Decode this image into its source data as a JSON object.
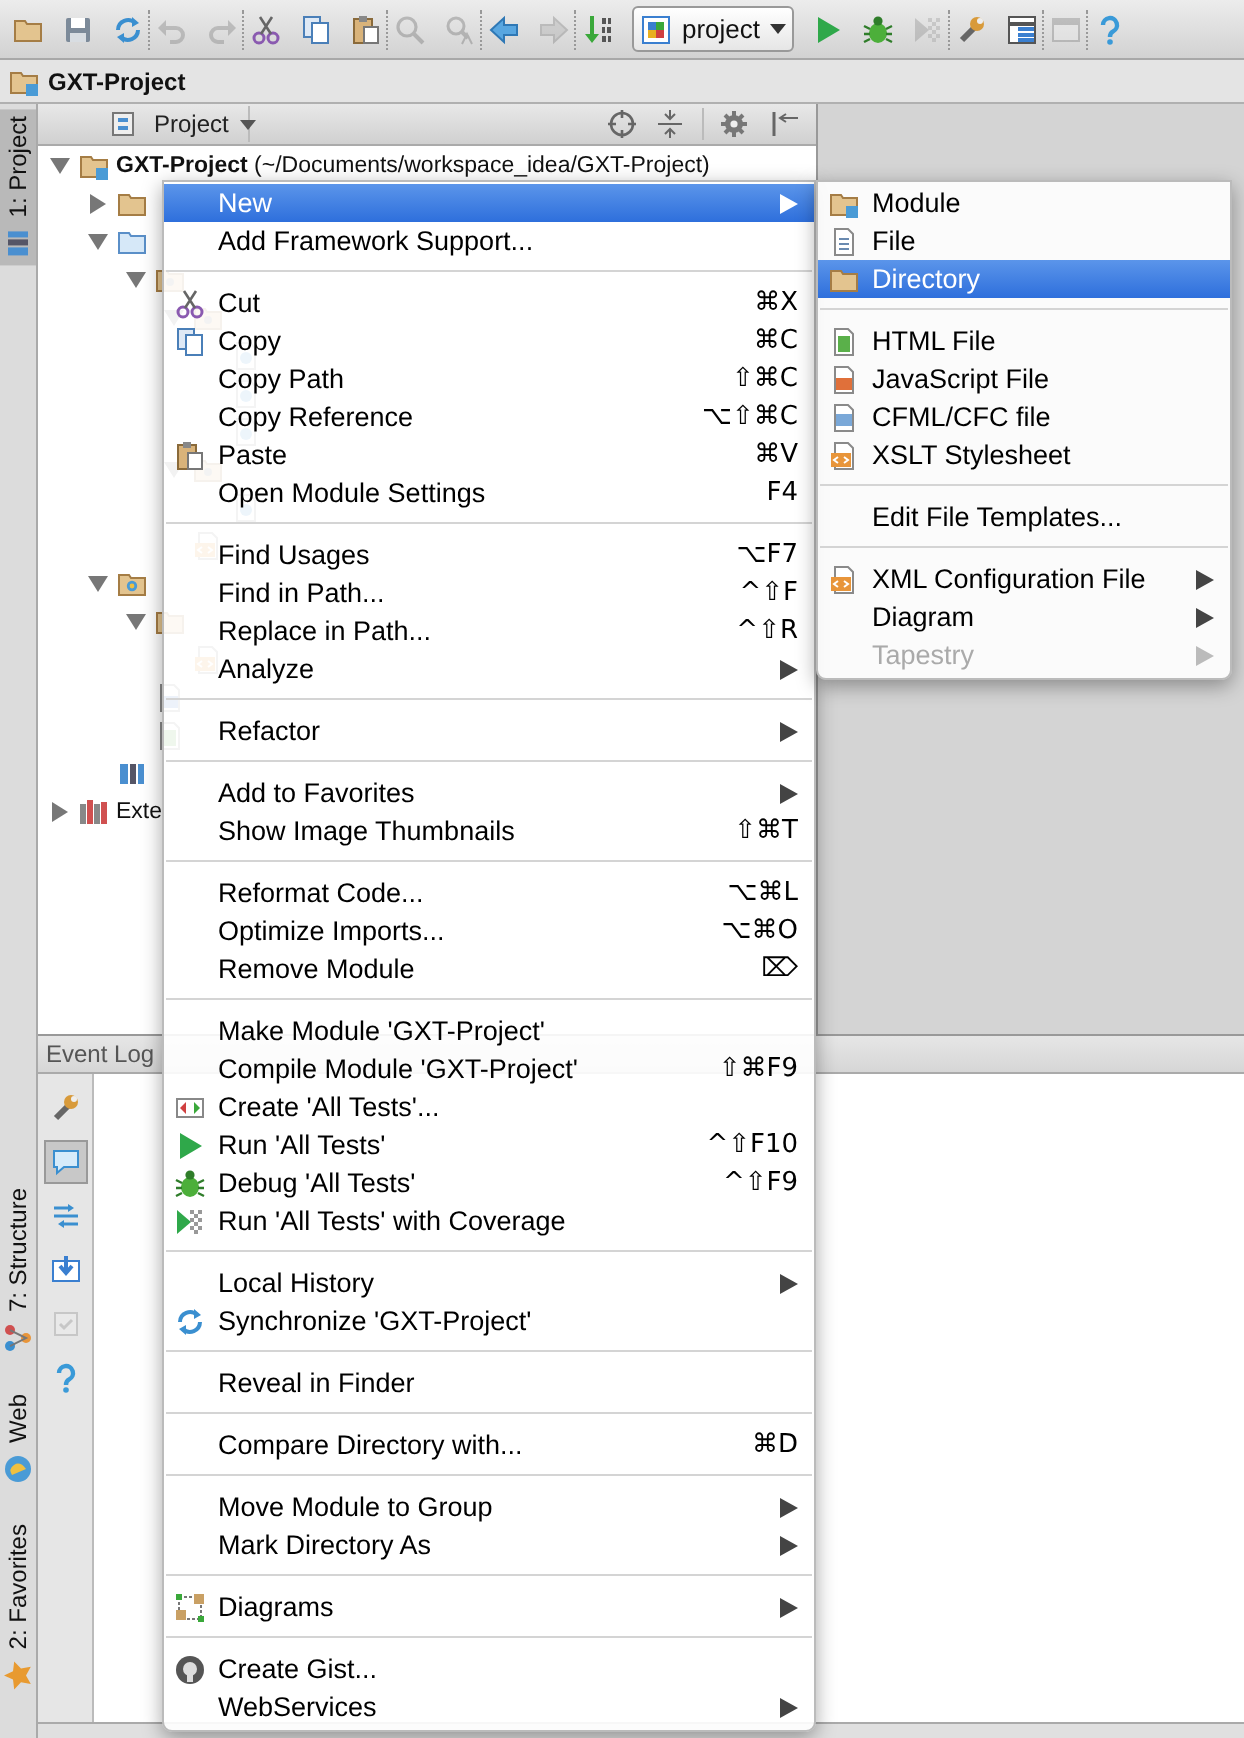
{
  "toolbar": [
    {
      "kind": "open",
      "disabled": false
    },
    {
      "kind": "save",
      "disabled": false
    },
    {
      "kind": "sync",
      "disabled": false
    },
    {
      "kind": "separator"
    },
    {
      "kind": "undo",
      "disabled": true
    },
    {
      "kind": "redo",
      "disabled": true
    },
    {
      "kind": "separator"
    },
    {
      "kind": "cut",
      "disabled": false
    },
    {
      "kind": "copy",
      "disabled": false
    },
    {
      "kind": "paste",
      "disabled": false
    },
    {
      "kind": "separator"
    },
    {
      "kind": "find",
      "disabled": true
    },
    {
      "kind": "replace",
      "disabled": true
    },
    {
      "kind": "separator"
    },
    {
      "kind": "back",
      "disabled": false
    },
    {
      "kind": "forward",
      "disabled": true
    },
    {
      "kind": "separator"
    },
    {
      "kind": "make",
      "disabled": false
    },
    {
      "kind": "config",
      "label": "project"
    },
    {
      "kind": "run",
      "disabled": false
    },
    {
      "kind": "debug",
      "disabled": false
    },
    {
      "kind": "coverage",
      "disabled": true
    },
    {
      "kind": "separator"
    },
    {
      "kind": "settings",
      "disabled": false
    },
    {
      "kind": "structure",
      "disabled": false
    },
    {
      "kind": "separator"
    },
    {
      "kind": "sdk",
      "disabled": true
    },
    {
      "kind": "separator"
    },
    {
      "kind": "help",
      "disabled": false
    }
  ],
  "breadcrumb": {
    "label": "GXT-Project"
  },
  "side_strip": {
    "tabs": [
      {
        "kind": "project",
        "label": "1: Project",
        "selected": true
      },
      {
        "kind": "structure",
        "label": "7: Structure",
        "selected": false
      },
      {
        "kind": "web",
        "label": "Web",
        "selected": false
      },
      {
        "kind": "favorites",
        "label": "2: Favorites",
        "selected": false
      }
    ]
  },
  "project_panel": {
    "view": "Project",
    "tree": [
      {
        "kind": "module",
        "label": "**GXT-Project** (~/Documents/workspace_idea/GXT-Project)",
        "expanded": true,
        "children": [
          {
            "kind": "folder",
            "expanded": false
          },
          {
            "kind": "source",
            "expanded": true,
            "children": [
              {
                "kind": "package",
                "expanded": true,
                "children": [
                  {
                    "kind": "package",
                    "expanded": true,
                    "children": [
                      {
                        "kind": "class"
                      },
                      {
                        "kind": "class"
                      },
                      {
                        "kind": "class"
                      }
                    ]
                  },
                  {
                    "kind": "package",
                    "expanded": true,
                    "children": [
                      {
                        "kind": "class"
                      }
                    ]
                  },
                  {
                    "kind": "xml"
                  }
                ]
              }
            ]
          },
          {
            "kind": "web",
            "expanded": true,
            "children": [
              {
                "kind": "folder",
                "expanded": true,
                "children": [
                  {
                    "kind": "xml"
                  }
                ]
              },
              {
                "kind": "css"
              },
              {
                "kind": "html"
              }
            ]
          },
          {
            "kind": "iml"
          }
        ]
      },
      {
        "kind": "library",
        "label": "Exte",
        "expanded": false
      }
    ]
  },
  "event_log": {
    "title": "Event Log",
    "tools": [
      {
        "kind": "settings",
        "selected": false,
        "disabled": false
      },
      {
        "kind": "messages",
        "selected": true,
        "disabled": false
      },
      {
        "kind": "expand",
        "selected": false,
        "disabled": false
      },
      {
        "kind": "import",
        "selected": false,
        "disabled": false
      },
      {
        "kind": "checkbox",
        "selected": false,
        "disabled": true
      },
      {
        "kind": "help",
        "selected": false,
        "disabled": false
      }
    ]
  },
  "context_menu": {
    "groups": [
      [
        {
          "kind": "plain",
          "label": "New",
          "submenu": true,
          "selected": true,
          "disabled": false
        },
        {
          "kind": "plain",
          "label": "Add Framework Support...",
          "submenu": false,
          "selected": false,
          "disabled": false
        }
      ],
      [
        {
          "kind": "cut",
          "label": "Cut",
          "shortcut": "⌘X",
          "submenu": false,
          "selected": false,
          "disabled": false
        },
        {
          "kind": "copy",
          "label": "Copy",
          "shortcut": "⌘C",
          "submenu": false,
          "selected": false,
          "disabled": false
        },
        {
          "kind": "plain",
          "label": "Copy Path",
          "shortcut": "⇧⌘C",
          "submenu": false,
          "selected": false,
          "disabled": false
        },
        {
          "kind": "plain",
          "label": "Copy Reference",
          "shortcut": "⌥⇧⌘C",
          "submenu": false,
          "selected": false,
          "disabled": false
        },
        {
          "kind": "paste",
          "label": "Paste",
          "shortcut": "⌘V",
          "submenu": false,
          "selected": false,
          "disabled": false
        },
        {
          "kind": "plain",
          "label": "Open Module Settings",
          "shortcut": "F4",
          "submenu": false,
          "selected": false,
          "disabled": false
        }
      ],
      [
        {
          "kind": "plain",
          "label": "Find Usages",
          "shortcut": "⌥F7",
          "submenu": false,
          "selected": false,
          "disabled": false
        },
        {
          "kind": "plain",
          "label": "Find in Path...",
          "shortcut": "^⇧F",
          "submenu": false,
          "selected": false,
          "disabled": false
        },
        {
          "kind": "plain",
          "label": "Replace in Path...",
          "shortcut": "^⇧R",
          "submenu": false,
          "selected": false,
          "disabled": false
        },
        {
          "kind": "plain",
          "label": "Analyze",
          "submenu": true,
          "selected": false,
          "disabled": false
        }
      ],
      [
        {
          "kind": "plain",
          "label": "Refactor",
          "submenu": true,
          "selected": false,
          "disabled": false
        }
      ],
      [
        {
          "kind": "plain",
          "label": "Add to Favorites",
          "submenu": true,
          "selected": false,
          "disabled": false
        },
        {
          "kind": "plain",
          "label": "Show Image Thumbnails",
          "shortcut": "⇧⌘T",
          "submenu": false,
          "selected": false,
          "disabled": false
        }
      ],
      [
        {
          "kind": "plain",
          "label": "Reformat Code...",
          "shortcut": "⌥⌘L",
          "submenu": false,
          "selected": false,
          "disabled": false
        },
        {
          "kind": "plain",
          "label": "Optimize Imports...",
          "shortcut": "⌥⌘O",
          "submenu": false,
          "selected": false,
          "disabled": false
        },
        {
          "kind": "plain",
          "label": "Remove Module",
          "shortcut": "⌦",
          "submenu": false,
          "selected": false,
          "disabled": false
        }
      ],
      [
        {
          "kind": "plain",
          "label": "Make Module 'GXT-Project'",
          "submenu": false,
          "selected": false,
          "disabled": false
        },
        {
          "kind": "plain",
          "label": "Compile Module 'GXT-Project'",
          "shortcut": "⇧⌘F9",
          "submenu": false,
          "selected": false,
          "disabled": false
        },
        {
          "kind": "tests",
          "label": "Create 'All Tests'...",
          "submenu": false,
          "selected": false,
          "disabled": false
        },
        {
          "kind": "run",
          "label": "Run 'All Tests'",
          "shortcut": "^⇧F10",
          "submenu": false,
          "selected": false,
          "disabled": false
        },
        {
          "kind": "debug",
          "label": "Debug 'All Tests'",
          "shortcut": "^⇧F9",
          "submenu": false,
          "selected": false,
          "disabled": false
        },
        {
          "kind": "coverage",
          "label": "Run 'All Tests' with Coverage",
          "submenu": false,
          "selected": false,
          "disabled": false
        }
      ],
      [
        {
          "kind": "plain",
          "label": "Local History",
          "submenu": true,
          "selected": false,
          "disabled": false
        },
        {
          "kind": "sync",
          "label": "Synchronize 'GXT-Project'",
          "submenu": false,
          "selected": false,
          "disabled": false
        }
      ],
      [
        {
          "kind": "plain",
          "label": "Reveal in Finder",
          "submenu": false,
          "selected": false,
          "disabled": false
        }
      ],
      [
        {
          "kind": "plain",
          "label": "Compare Directory with...",
          "shortcut": "⌘D",
          "submenu": false,
          "selected": false,
          "disabled": false
        }
      ],
      [
        {
          "kind": "plain",
          "label": "Move Module to Group",
          "submenu": true,
          "selected": false,
          "disabled": false
        },
        {
          "kind": "plain",
          "label": "Mark Directory As",
          "submenu": true,
          "selected": false,
          "disabled": false
        }
      ],
      [
        {
          "kind": "diagram",
          "label": "Diagrams",
          "submenu": true,
          "selected": false,
          "disabled": false
        }
      ],
      [
        {
          "kind": "gist",
          "label": "Create Gist...",
          "submenu": false,
          "selected": false,
          "disabled": false
        },
        {
          "kind": "plain",
          "label": "WebServices",
          "submenu": true,
          "selected": false,
          "disabled": false
        }
      ]
    ]
  },
  "submenu": {
    "groups": [
      [
        {
          "kind": "module",
          "label": "Module",
          "submenu": false,
          "selected": false,
          "disabled": false
        },
        {
          "kind": "file",
          "label": "File",
          "submenu": false,
          "selected": false,
          "disabled": false
        },
        {
          "kind": "folder",
          "label": "Directory",
          "submenu": false,
          "selected": true,
          "disabled": false
        }
      ],
      [
        {
          "kind": "html",
          "label": "HTML File",
          "submenu": false,
          "selected": false,
          "disabled": false
        },
        {
          "kind": "js",
          "label": "JavaScript File",
          "submenu": false,
          "selected": false,
          "disabled": false
        },
        {
          "kind": "cf",
          "label": "CFML/CFC file",
          "submenu": false,
          "selected": false,
          "disabled": false
        },
        {
          "kind": "xml",
          "label": "XSLT Stylesheet",
          "submenu": false,
          "selected": false,
          "disabled": false
        }
      ],
      [
        {
          "kind": "plain",
          "label": "Edit File Templates...",
          "submenu": false,
          "selected": false,
          "disabled": false
        }
      ],
      [
        {
          "kind": "xml",
          "label": "XML Configuration File",
          "submenu": true,
          "selected": false,
          "disabled": false
        },
        {
          "kind": "plain",
          "label": "Diagram",
          "submenu": true,
          "selected": false,
          "disabled": false
        },
        {
          "kind": "plain",
          "label": "Tapestry",
          "submenu": true,
          "selected": false,
          "disabled": true
        }
      ]
    ]
  }
}
